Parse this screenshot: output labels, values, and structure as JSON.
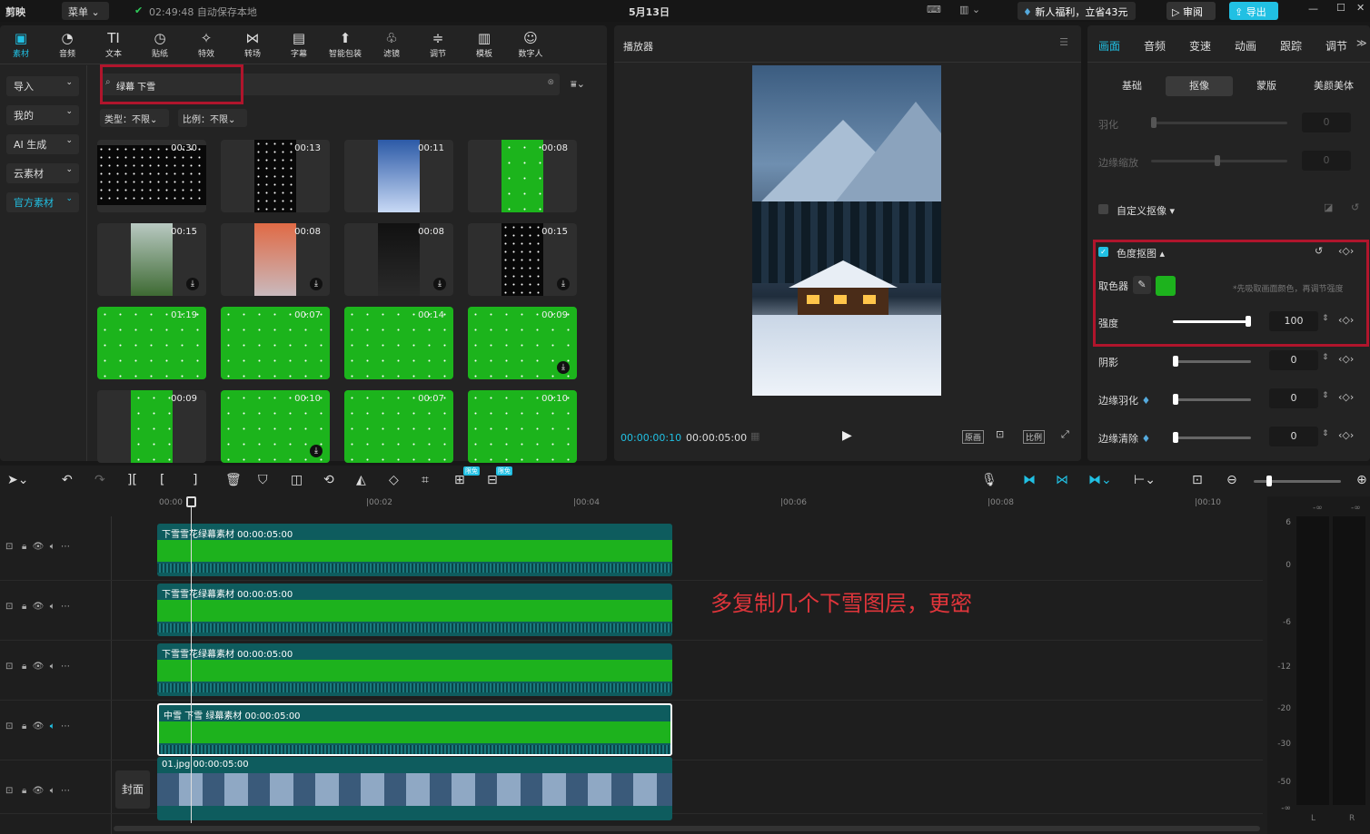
{
  "topbar": {
    "logo": "剪映",
    "menu": "菜单",
    "autosave": "02:49:48 自动保存本地",
    "title": "5月13日",
    "promo": "新人福利，立省43元",
    "review": "审阅",
    "export": "导出"
  },
  "tools": [
    {
      "label": "素材",
      "icon": "▣"
    },
    {
      "label": "音频",
      "icon": "◔"
    },
    {
      "label": "文本",
      "icon": "TI"
    },
    {
      "label": "贴纸",
      "icon": "◷"
    },
    {
      "label": "特效",
      "icon": "✧"
    },
    {
      "label": "转场",
      "icon": "⋈"
    },
    {
      "label": "字幕",
      "icon": "▤"
    },
    {
      "label": "智能包装",
      "icon": "⬆"
    },
    {
      "label": "滤镜",
      "icon": "♧"
    },
    {
      "label": "调节",
      "icon": "≑"
    },
    {
      "label": "模板",
      "icon": "▥"
    },
    {
      "label": "数字人",
      "icon": "☺"
    }
  ],
  "sidebar": [
    {
      "label": "导入"
    },
    {
      "label": "我的"
    },
    {
      "label": "AI 生成"
    },
    {
      "label": "云素材"
    },
    {
      "label": "官方素材"
    }
  ],
  "search": {
    "value": "绿幕 下雪"
  },
  "filters": {
    "type": "类型：不限",
    "ratio": "比例：不限"
  },
  "thumbs": [
    {
      "dur": "00:30",
      "kind": "snow"
    },
    {
      "dur": "00:13",
      "kind": "snow"
    },
    {
      "dur": "00:11",
      "kind": "blue"
    },
    {
      "dur": "00:08",
      "kind": "green"
    },
    {
      "dur": "00:15",
      "kind": "photo"
    },
    {
      "dur": "00:08",
      "kind": "red"
    },
    {
      "dur": "00:08",
      "kind": "dark"
    },
    {
      "dur": "00:15",
      "kind": "snow"
    },
    {
      "dur": "01:19",
      "kind": "green"
    },
    {
      "dur": "00:07",
      "kind": "green"
    },
    {
      "dur": "00:14",
      "kind": "green"
    },
    {
      "dur": "00:09",
      "kind": "green"
    },
    {
      "dur": "00:09",
      "kind": "green"
    },
    {
      "dur": "00:10",
      "kind": "green"
    },
    {
      "dur": "00:07",
      "kind": "green"
    },
    {
      "dur": "00:10",
      "kind": "green"
    }
  ],
  "player": {
    "title": "播放器",
    "current": "00:00:00:10",
    "total": "00:00:05:00",
    "btn_original": "原画",
    "btn_ratio": "比例"
  },
  "props": {
    "tabs": [
      "画面",
      "音频",
      "变速",
      "动画",
      "跟踪",
      "调节"
    ],
    "subtabs": [
      "基础",
      "抠像",
      "蒙版",
      "美颜美体"
    ],
    "feather": "羽化",
    "edge_scale": "边缘缩放",
    "custom_cutout": "自定义抠像",
    "chroma": "色度抠图",
    "picker": "取色器",
    "picker_hint": "*先吸取画面颜色，再调节强度",
    "strength": "强度",
    "strength_val": "100",
    "shadow": "阴影",
    "shadow_val": "0",
    "edge_feather": "边缘羽化",
    "edge_feather_val": "0",
    "edge_clear": "边缘清除",
    "edge_clear_val": "0",
    "zero": "0",
    "accent": "#21c0e3",
    "pick_color": "#1db21d"
  },
  "ruler": [
    "00:00",
    "|00:02",
    "|00:04",
    "|00:06",
    "|00:08",
    "|00:10"
  ],
  "clips": [
    {
      "label": "下雪雪花绿幕素材  00:00:05:00"
    },
    {
      "label": "下雪雪花绿幕素材  00:00:05:00"
    },
    {
      "label": "下雪雪花绿幕素材  00:00:05:00"
    },
    {
      "label": "中雪 下雪 绿幕素材  00:00:05:00"
    },
    {
      "label": "01.jpg  00:00:05:00"
    }
  ],
  "cover": "封面",
  "annotation": "多复制几个下雪图层，更密",
  "meter": {
    "scale": [
      "6",
      "0",
      "-6",
      "-12",
      "-20",
      "-30",
      "-50",
      "-∞"
    ],
    "top": "-∞",
    "left": "L",
    "right": "R"
  },
  "badge": "限免"
}
